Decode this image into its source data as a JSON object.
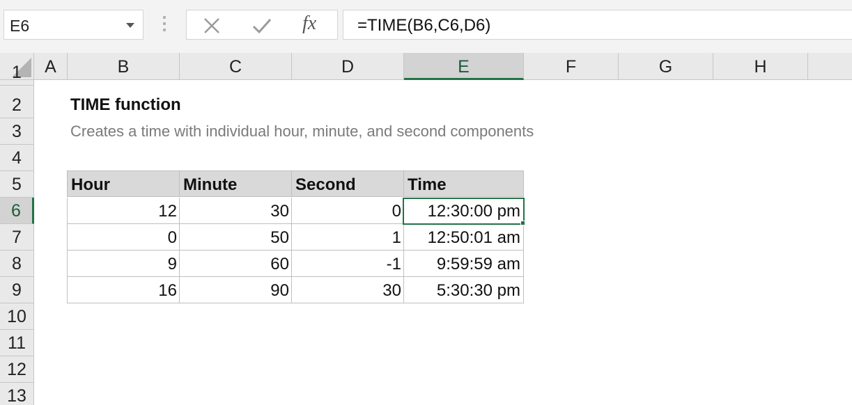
{
  "formula_bar": {
    "name_box": "E6",
    "formula": "=TIME(B6,C6,D6)",
    "fx_label": "fx"
  },
  "columns": [
    "A",
    "B",
    "C",
    "D",
    "E",
    "F",
    "G",
    "H"
  ],
  "selected_column": "E",
  "rows": [
    "1",
    "2",
    "3",
    "4",
    "5",
    "6",
    "7",
    "8",
    "9",
    "10",
    "11",
    "12",
    "13"
  ],
  "selected_row": "6",
  "sheet": {
    "title": "TIME function",
    "subtitle": "Creates a time with individual hour, minute, and second components",
    "table": {
      "headers": [
        "Hour",
        "Minute",
        "Second",
        "Time"
      ],
      "rows": [
        [
          "12",
          "30",
          "0",
          "12:30:00 pm"
        ],
        [
          "0",
          "50",
          "1",
          "12:50:01 am"
        ],
        [
          "9",
          "60",
          "-1",
          "9:59:59 am"
        ],
        [
          "16",
          "90",
          "30",
          "5:30:30 pm"
        ]
      ]
    }
  },
  "colors": {
    "accent": "#217346",
    "header_fill": "#d9d9d9",
    "subtitle_text": "#7a7a7a"
  }
}
